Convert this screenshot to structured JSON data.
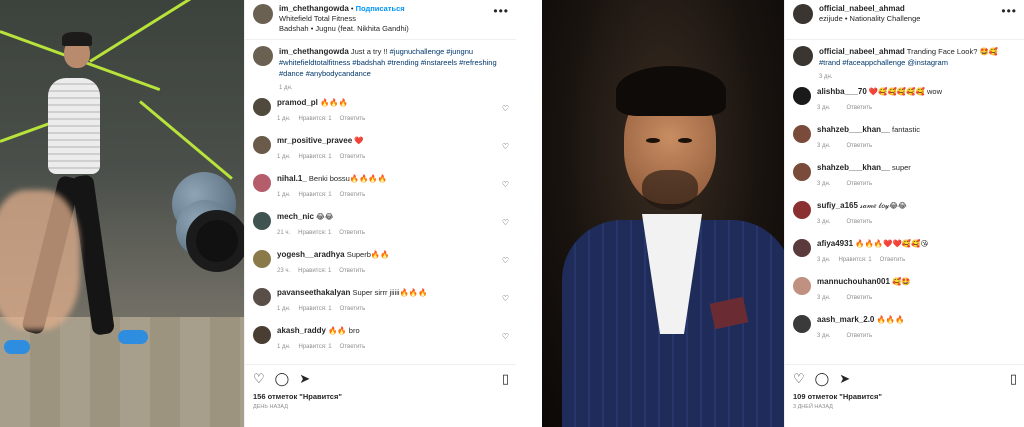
{
  "post1": {
    "username": "im_chethangowda",
    "location": "Whitefield Total Fitness",
    "audio": "Badshah • Jugnu (feat. Nikhita Gandhi)",
    "more_icon": "more-horizontal-icon",
    "caption_user": "im_chethangowda",
    "caption_text": "Just a try !! ",
    "caption_tags": "#jugnuchallenge #jungnu #whitefieldtotalfitness #badshah #trending #instareels #refreshing #dance #anybodycandance",
    "caption_time": "1 дн.",
    "comments": [
      {
        "user": "pramod_pl",
        "text": "🔥🔥🔥",
        "time": "1 дн.",
        "likes": "Нравится: 1",
        "reply": "Ответить",
        "avatar_color": "#4f4a3d"
      },
      {
        "user": "mr_positive_pravee",
        "text": "❤️",
        "time": "1 дн.",
        "likes": "Нравится: 1",
        "reply": "Ответить",
        "avatar_color": "#6a5a4a"
      },
      {
        "user": "nihal.1_",
        "text": "Benki bossu🔥🔥🔥🔥",
        "time": "1 дн.",
        "likes": "Нравится: 1",
        "reply": "Ответить",
        "avatar_color": "#b55d6b"
      },
      {
        "user": "mech_nic",
        "text": "😂😂",
        "time": "21 ч.",
        "likes": "Нравится: 1",
        "reply": "Ответить",
        "avatar_color": "#3f5350"
      },
      {
        "user": "yogesh__aradhya",
        "text": "Superb🔥🔥",
        "time": "23 ч.",
        "likes": "Нравится: 1",
        "reply": "Ответить",
        "avatar_color": "#8a7a4a"
      },
      {
        "user": "pavanseethakalyan",
        "text": "Super sirrr jiiiii🔥🔥🔥",
        "time": "1 дн.",
        "likes": "Нравится: 1",
        "reply": "Ответить",
        "avatar_color": "#5a4f48"
      },
      {
        "user": "akash_raddy",
        "text": "🔥🔥 bro",
        "time": "1 дн.",
        "likes": "Нравится: 1",
        "reply": "Ответить",
        "avatar_color": "#4a3d32"
      }
    ],
    "likes": "156 отметок \"Нравится\"",
    "posted_ago": "день назад"
  },
  "post2": {
    "username": "official_nabeel_ahmad",
    "location": "ezijude • Nationality Challenge",
    "more_icon": "more-horizontal-icon",
    "caption_user": "official_nabeel_ahmad",
    "caption_text": "Tranding Face Look? 🤩🥰 ",
    "caption_tags": "#trand #faceappchallenge @instagram",
    "caption_time": "3 дн.",
    "comments": [
      {
        "user": "alishba___70",
        "text": "❤️🥰🥰🥰🥰🥰 wow",
        "time": "3 дн.",
        "likes": "",
        "reply": "Ответить",
        "avatar_color": "#1a1a1a"
      },
      {
        "user": "shahzeb___khan__",
        "text": "fantastic",
        "time": "3 дн.",
        "likes": "",
        "reply": "Ответить",
        "avatar_color": "#7a4a3a"
      },
      {
        "user": "shahzeb___khan__",
        "text": "super",
        "time": "3 дн.",
        "likes": "",
        "reply": "Ответить",
        "avatar_color": "#7a4a3a"
      },
      {
        "user": "sufiy_a165",
        "text": "𝓈𝒶𝓂𝑒 𝒷𝑜𝓎😂😂",
        "time": "3 дн.",
        "likes": "",
        "reply": "Ответить",
        "avatar_color": "#8a3030"
      },
      {
        "user": "afiya4931",
        "text": "🔥🔥🔥❤️❤️🥰🥰😘",
        "time": "3 дн.",
        "likes": "Нравится: 1",
        "reply": "Ответить",
        "avatar_color": "#5a3a3a"
      },
      {
        "user": "mannuchouhan001",
        "text": "🥰🤩",
        "time": "3 дн.",
        "likes": "",
        "reply": "Ответить",
        "avatar_color": "#c09080"
      },
      {
        "user": "aash_mark_2.0",
        "text": "🔥🔥🔥",
        "time": "3 дн.",
        "likes": "",
        "reply": "Ответить",
        "avatar_color": "#3a3a3a"
      }
    ],
    "likes": "109 отметок \"Нравится\"",
    "posted_ago": "3 дней назад"
  }
}
